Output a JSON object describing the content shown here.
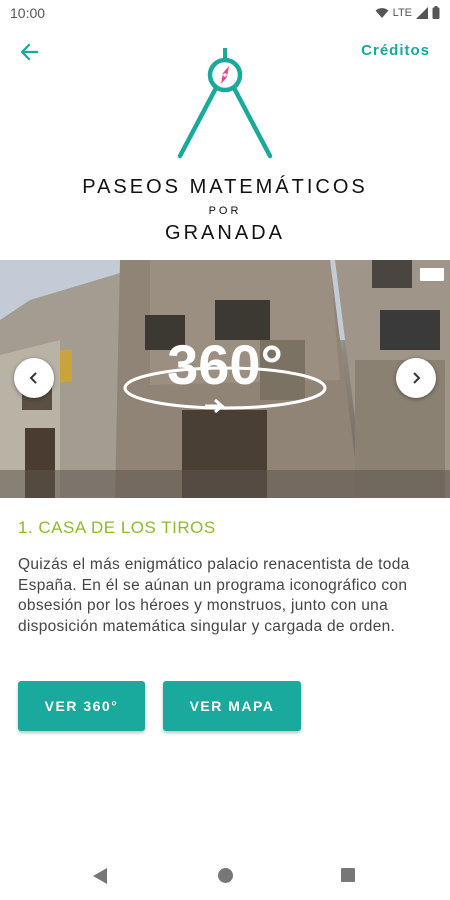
{
  "status_bar": {
    "time": "10:00",
    "network": "LTE",
    "icons": [
      "wifi-icon",
      "signal-icon",
      "battery-icon"
    ]
  },
  "header": {
    "back_icon": "arrow-left-icon",
    "credits_label": "Créditos"
  },
  "app_title": {
    "line1": "PASEOS MATEMÁTICOS",
    "line2": "POR",
    "line3": "GRANADA"
  },
  "hero": {
    "overlay_text": "360°",
    "prev_icon": "chevron-left-icon",
    "next_icon": "chevron-right-icon"
  },
  "place": {
    "title": "1. CASA DE LOS TIROS",
    "description": "Quizás el más enigmático palacio renacentista de toda España. En él se aúnan un programa iconográfico con obsesión por los héroes y monstruos, junto con una disposición matemática singular y cargada de orden."
  },
  "actions": {
    "view_360_label": "VER 360°",
    "view_map_label": "VER MAPA"
  },
  "colors": {
    "accent": "#19a99d",
    "title_green": "#8dbb2c",
    "compass_pink": "#e8457b"
  },
  "nav_bar": {
    "icons": [
      "nav-back-icon",
      "nav-home-icon",
      "nav-recents-icon"
    ]
  }
}
